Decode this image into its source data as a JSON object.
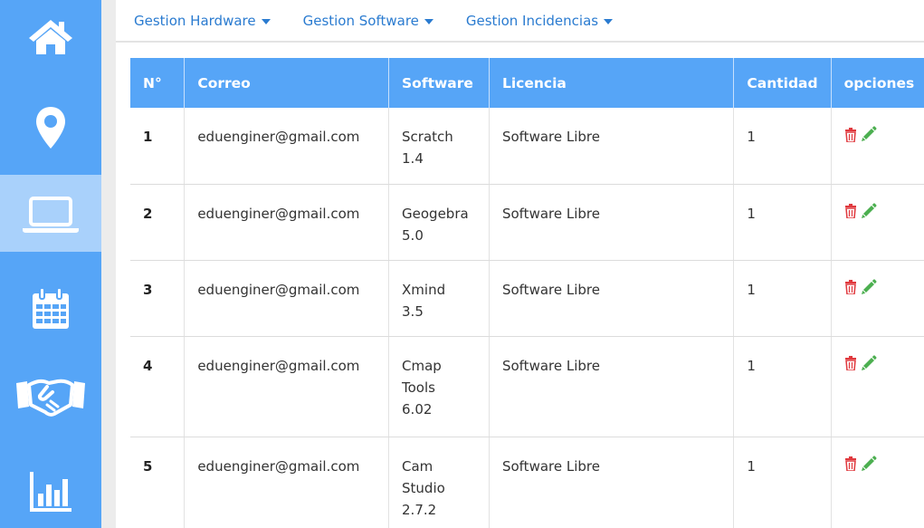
{
  "sidebar": {
    "items": [
      {
        "icon": "home-icon"
      },
      {
        "icon": "location-pin-icon"
      },
      {
        "icon": "laptop-icon",
        "active": true
      },
      {
        "icon": "calendar-icon"
      },
      {
        "icon": "handshake-icon"
      },
      {
        "icon": "bar-chart-icon"
      }
    ]
  },
  "nav": {
    "hardware": "Gestion Hardware",
    "software": "Gestion Software",
    "incidencias": "Gestion Incidencias"
  },
  "table": {
    "headers": [
      "N°",
      "Correo",
      "Software",
      "Licencia",
      "Cantidad",
      "opciones"
    ],
    "rows": [
      {
        "n": "1",
        "correo": "eduenginer@gmail.com",
        "software": [
          "Scratch",
          "1.4"
        ],
        "licencia": "Software Libre",
        "cantidad": "1"
      },
      {
        "n": "2",
        "correo": "eduenginer@gmail.com",
        "software": [
          "Geogebra",
          "5.0"
        ],
        "licencia": "Software Libre",
        "cantidad": "1"
      },
      {
        "n": "3",
        "correo": "eduenginer@gmail.com",
        "software": [
          "Xmind",
          "3.5"
        ],
        "licencia": "Software Libre",
        "cantidad": "1"
      },
      {
        "n": "4",
        "correo": "eduenginer@gmail.com",
        "software": [
          "Cmap",
          "Tools",
          "6.02"
        ],
        "licencia": "Software Libre",
        "cantidad": "1"
      },
      {
        "n": "5",
        "correo": "eduenginer@gmail.com",
        "software": [
          "Cam",
          "Studio",
          "2.7.2"
        ],
        "licencia": "Software Libre",
        "cantidad": "1"
      }
    ]
  },
  "colors": {
    "primary": "#56a5f7",
    "sidebar_active": "#a9d1fb",
    "link": "#2a7bd0",
    "delete": "#e0393e",
    "edit": "#4caf50"
  },
  "icons": {
    "delete": "trash-icon",
    "edit": "pencil-icon"
  }
}
